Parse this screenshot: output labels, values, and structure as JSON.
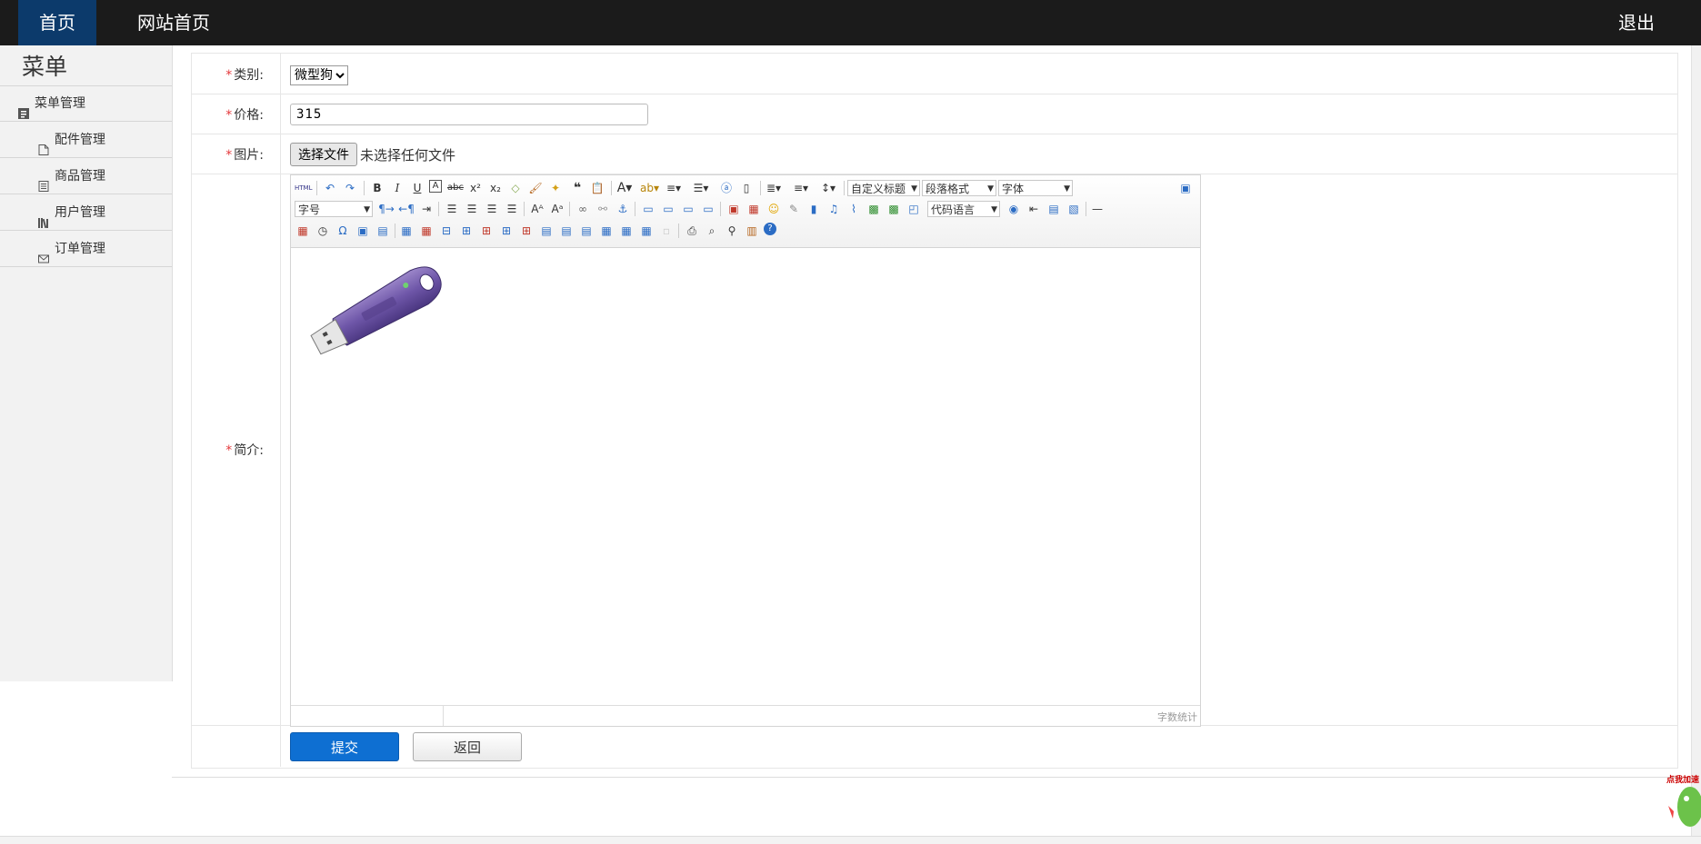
{
  "nav": {
    "home": "首页",
    "site_home": "网站首页",
    "logout": "退出"
  },
  "sidebar": {
    "title": "菜单",
    "items": [
      {
        "label": "菜单管理",
        "icon": "list-icon"
      },
      {
        "label": "配件管理",
        "icon": "file-icon"
      },
      {
        "label": "商品管理",
        "icon": "document-icon"
      },
      {
        "label": "用户管理",
        "icon": "books-icon"
      },
      {
        "label": "订单管理",
        "icon": "mail-icon"
      }
    ]
  },
  "form": {
    "required_mark": "*",
    "category": {
      "label": "类别:",
      "value": "微型狗"
    },
    "price": {
      "label": "价格:",
      "value": "315"
    },
    "image": {
      "label": "图片:",
      "button": "选择文件",
      "status": "未选择任何文件"
    },
    "intro": {
      "label": "简介:"
    },
    "editor": {
      "dropdowns": {
        "custom_heading": "自定义标题",
        "paragraph": "段落格式",
        "font_family": "字体",
        "font_size": "字号",
        "code_lang": "代码语言"
      },
      "word_count": "字数统计",
      "content_image": "usb-dongle-image"
    },
    "submit": "提交",
    "back": "返回"
  },
  "widget": {
    "label": "点我加速"
  },
  "colors": {
    "topbar": "#1b1b1b",
    "nav_active": "#0c3a6b",
    "submit": "#0e6fd2",
    "required": "#e4393c"
  }
}
